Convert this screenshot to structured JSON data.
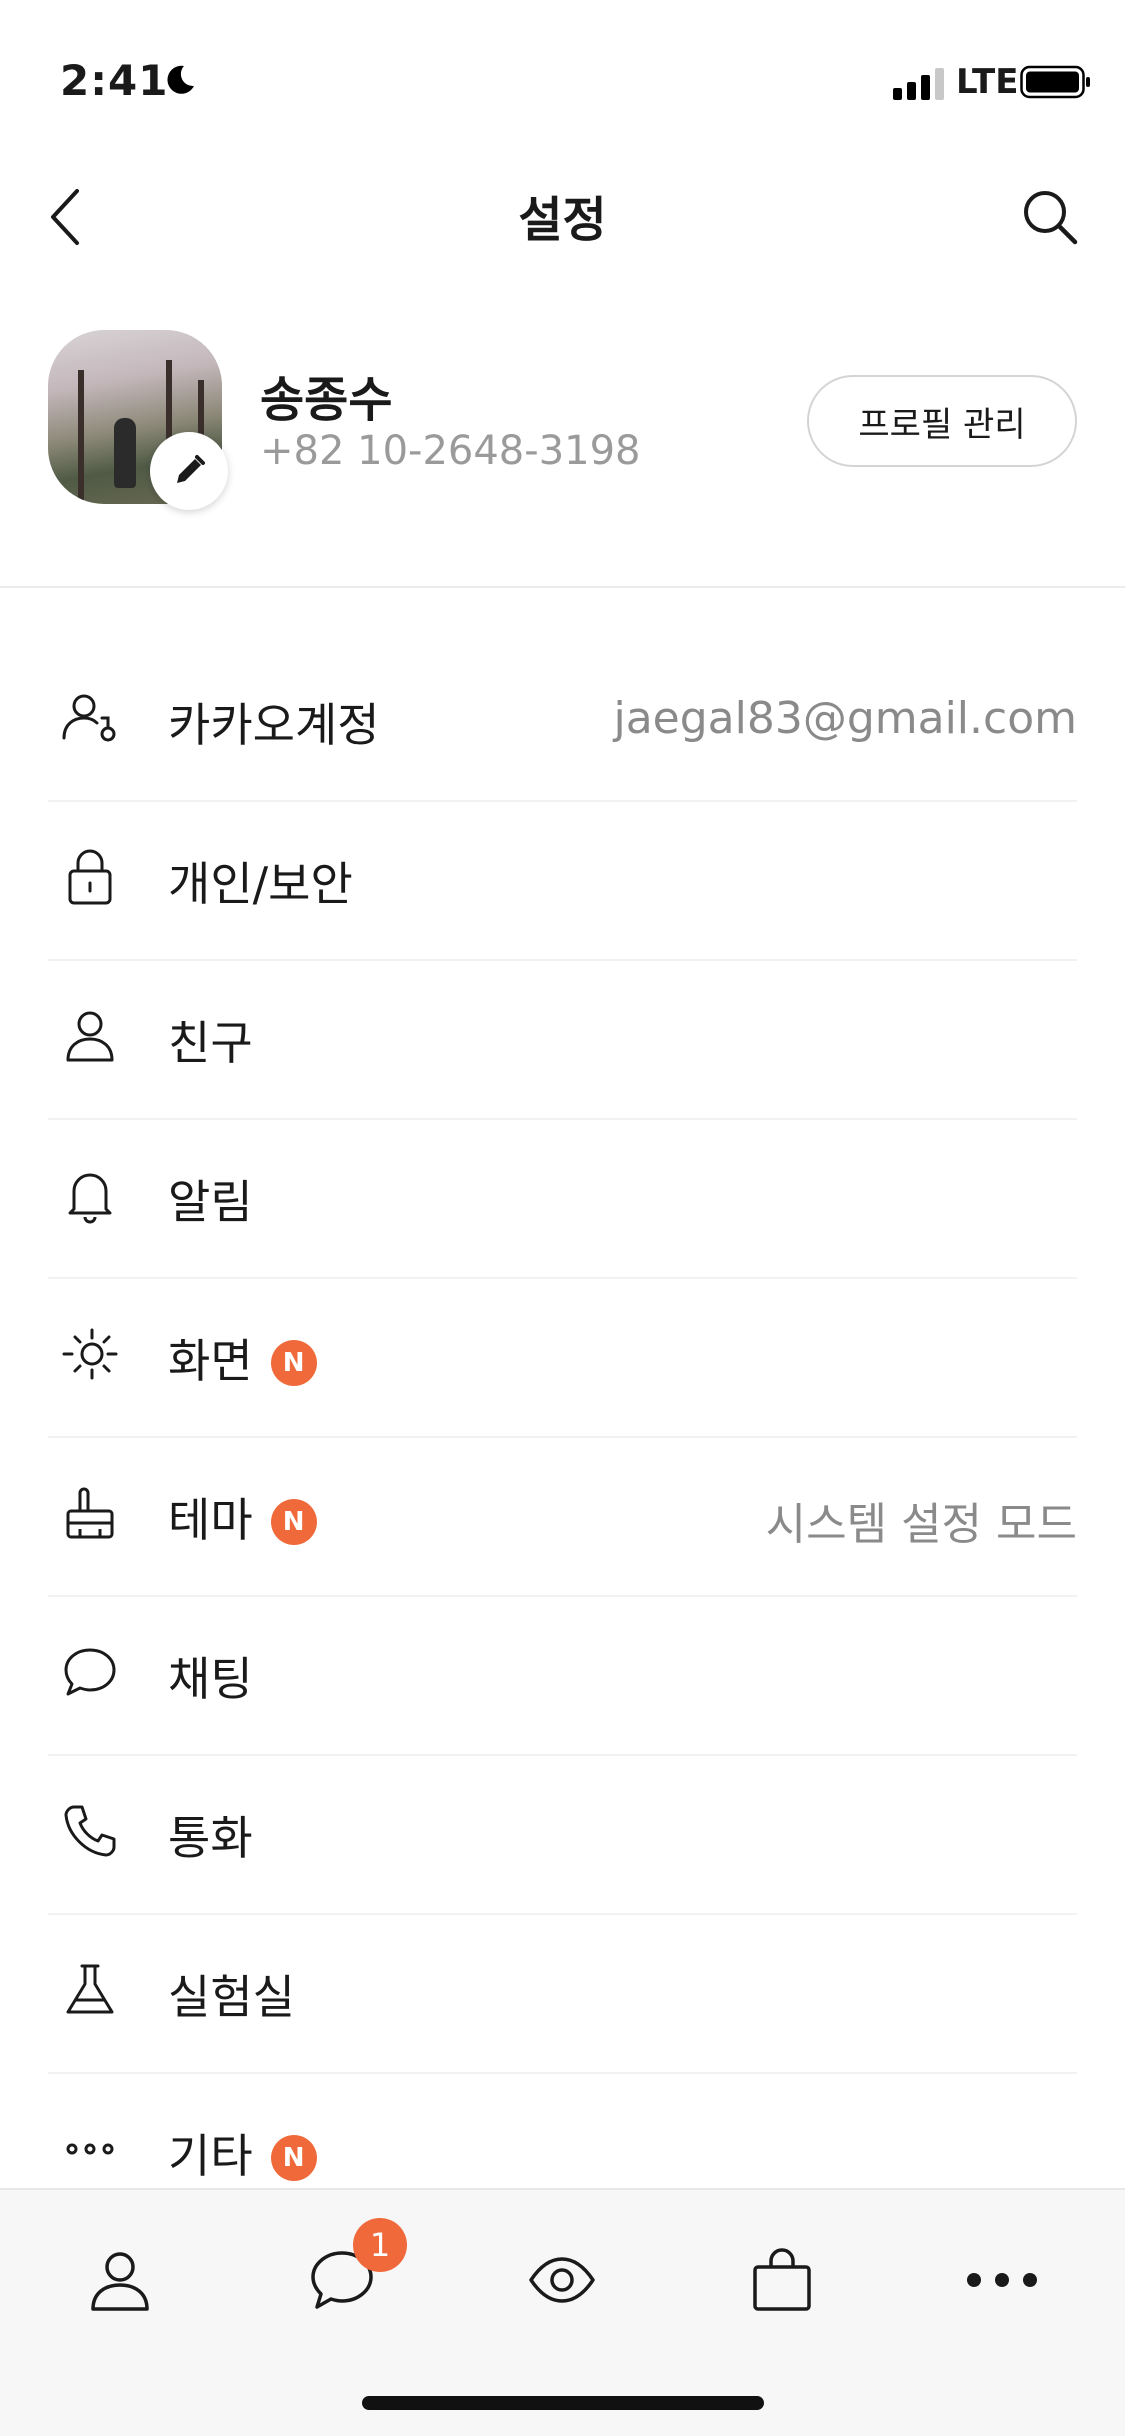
{
  "status_bar": {
    "time": "2:41",
    "network": "LTE"
  },
  "header": {
    "title": "설정"
  },
  "profile": {
    "name": "송종수",
    "phone": "+82 10-2648-3198",
    "manage_label": "프로필 관리"
  },
  "settings": [
    {
      "icon": "account-icon",
      "label": "카카오계정",
      "value": "jaegal83@gmail.com",
      "badge": ""
    },
    {
      "icon": "lock-icon",
      "label": "개인/보안",
      "value": "",
      "badge": ""
    },
    {
      "icon": "person-icon",
      "label": "친구",
      "value": "",
      "badge": ""
    },
    {
      "icon": "bell-icon",
      "label": "알림",
      "value": "",
      "badge": ""
    },
    {
      "icon": "brightness-icon",
      "label": "화면",
      "value": "",
      "badge": "N"
    },
    {
      "icon": "theme-icon",
      "label": "테마",
      "value": "시스템 설정 모드",
      "badge": "N"
    },
    {
      "icon": "chat-bubble-icon",
      "label": "채팅",
      "value": "",
      "badge": ""
    },
    {
      "icon": "phone-icon",
      "label": "통화",
      "value": "",
      "badge": ""
    },
    {
      "icon": "flask-icon",
      "label": "실험실",
      "value": "",
      "badge": ""
    },
    {
      "icon": "more-icon",
      "label": "기타",
      "value": "",
      "badge": "N"
    }
  ],
  "tab_bar": {
    "tabs": [
      {
        "icon": "friends-tab-icon"
      },
      {
        "icon": "chats-tab-icon"
      },
      {
        "icon": "view-tab-icon"
      },
      {
        "icon": "shopping-tab-icon"
      },
      {
        "icon": "more-tab-icon"
      }
    ],
    "chat_badge": "1"
  },
  "colors": {
    "accent_badge": "#f0693a",
    "secondary_text": "#8a8a8a"
  }
}
